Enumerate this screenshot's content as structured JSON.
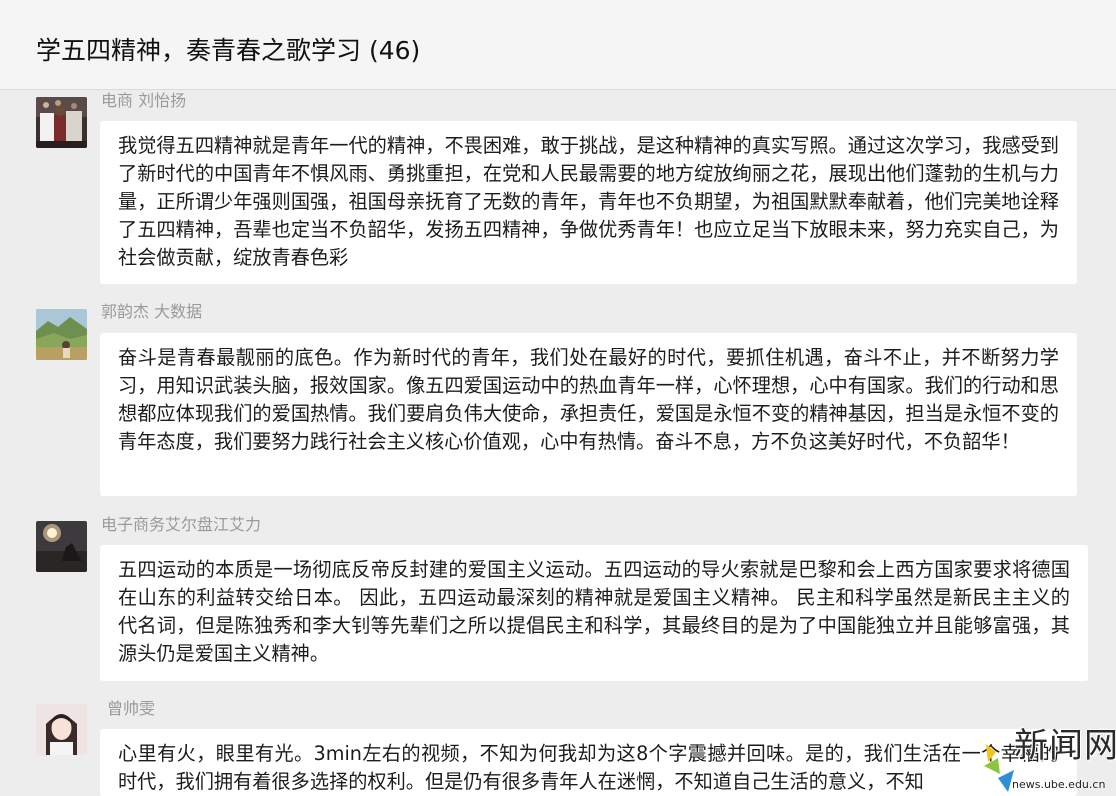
{
  "header": {
    "title": "学五四精神，奏青春之歌学习 (46)"
  },
  "messages": [
    {
      "sender": "电商 刘怡扬",
      "text": "我觉得五四精神就是青年一代的精神，不畏困难，敢于挑战，是这种精神的真实写照。通过这次学习，我感受到了新时代的中国青年不惧风雨、勇挑重担，在党和人民最需要的地方绽放绚丽之花，展现出他们蓬勃的生机与力量，正所谓少年强则国强，祖国母亲抚育了无数的青年，青年也不负期望，为祖国默默奉献着，他们完美地诠释了五四精神，吾辈也定当不负韶华，发扬五四精神，争做优秀青年！也应立足当下放眼未来，努力充实自己，为社会做贡献，绽放青春色彩"
    },
    {
      "sender": "郭韵杰 大数据",
      "text": "奋斗是青春最靓丽的底色。作为新时代的青年，我们处在最好的时代，要抓住机遇，奋斗不止，并不断努力学习，用知识武装头脑，报效国家。像五四爱国运动中的热血青年一样，心怀理想，心中有国家。我们的行动和思想都应体现我们的爱国热情。我们要肩负伟大使命，承担责任，爱国是永恒不变的精神基因，担当是永恒不变的青年态度，我们要努力践行社会主义核心价值观，心中有热情。奋斗不息，方不负这美好时代，不负韶华！"
    },
    {
      "sender": "电子商务艾尔盘江艾力",
      "text": "五四运动的本质是一场彻底反帝反封建的爱国主义运动。五四运动的导火索就是巴黎和会上西方国家要求将德国在山东的利益转交给日本。 因此，五四运动最深刻的精神就是爱国主义精神。 民主和科学虽然是新民主主义的代名词，但是陈独秀和李大钊等先辈们之所以提倡民主和科学，其最终目的是为了中国能独立并且能够富强，其源头仍是爱国主义精神。"
    },
    {
      "sender": "曾帅雯",
      "text": "心里有火，眼里有光。3min左右的视频，不知为何我却为这8个字震撼并回味。是的，我们生活在一个幸福的时代，我们拥有着很多选择的权利。但是仍有很多青年人在迷惘，不知道自己生活的意义，不知"
    }
  ],
  "watermark": {
    "text": "新闻网",
    "url": "news.ube.edu.cn"
  }
}
